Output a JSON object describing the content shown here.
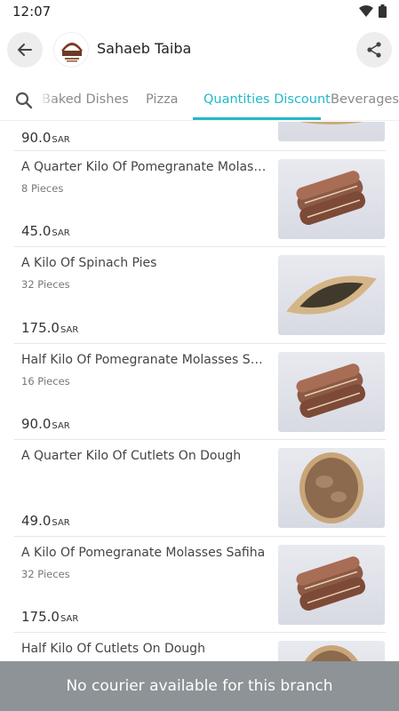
{
  "status": {
    "time": "12:07"
  },
  "header": {
    "title": "Sahaeb Taiba"
  },
  "tabs": [
    {
      "label": "Baked Dishes"
    },
    {
      "label": "Pizza"
    },
    {
      "label": "Quantities Discount"
    },
    {
      "label": "Beverages"
    }
  ],
  "items": [
    {
      "name": "",
      "pieces": "",
      "price": "90.0",
      "currency": "SAR",
      "image": "spinach-pie"
    },
    {
      "name": "A Quarter Kilo Of Pomegranate Molasses Safiha",
      "pieces": "8 Pieces",
      "price": "45.0",
      "currency": "SAR",
      "image": "safiha"
    },
    {
      "name": "A Kilo Of Spinach Pies",
      "pieces": "32 Pieces",
      "price": "175.0",
      "currency": "SAR",
      "image": "spinach-pie"
    },
    {
      "name": "Half Kilo Of Pomegranate Molasses Safiha",
      "pieces": "16 Pieces",
      "price": "90.0",
      "currency": "SAR",
      "image": "safiha"
    },
    {
      "name": "A Quarter Kilo Of Cutlets On Dough",
      "pieces": "",
      "price": "49.0",
      "currency": "SAR",
      "image": "cutlet"
    },
    {
      "name": "A Kilo Of Pomegranate Molasses Safiha",
      "pieces": "32 Pieces",
      "price": "175.0",
      "currency": "SAR",
      "image": "safiha"
    },
    {
      "name": "Half Kilo Of Cutlets On Dough",
      "pieces": "",
      "price": "",
      "currency": "",
      "image": "cutlet"
    }
  ],
  "toast": {
    "message": "No courier available for this branch"
  },
  "colors": {
    "accent": "#22b8c7",
    "toast_bg": "#8d9396"
  }
}
